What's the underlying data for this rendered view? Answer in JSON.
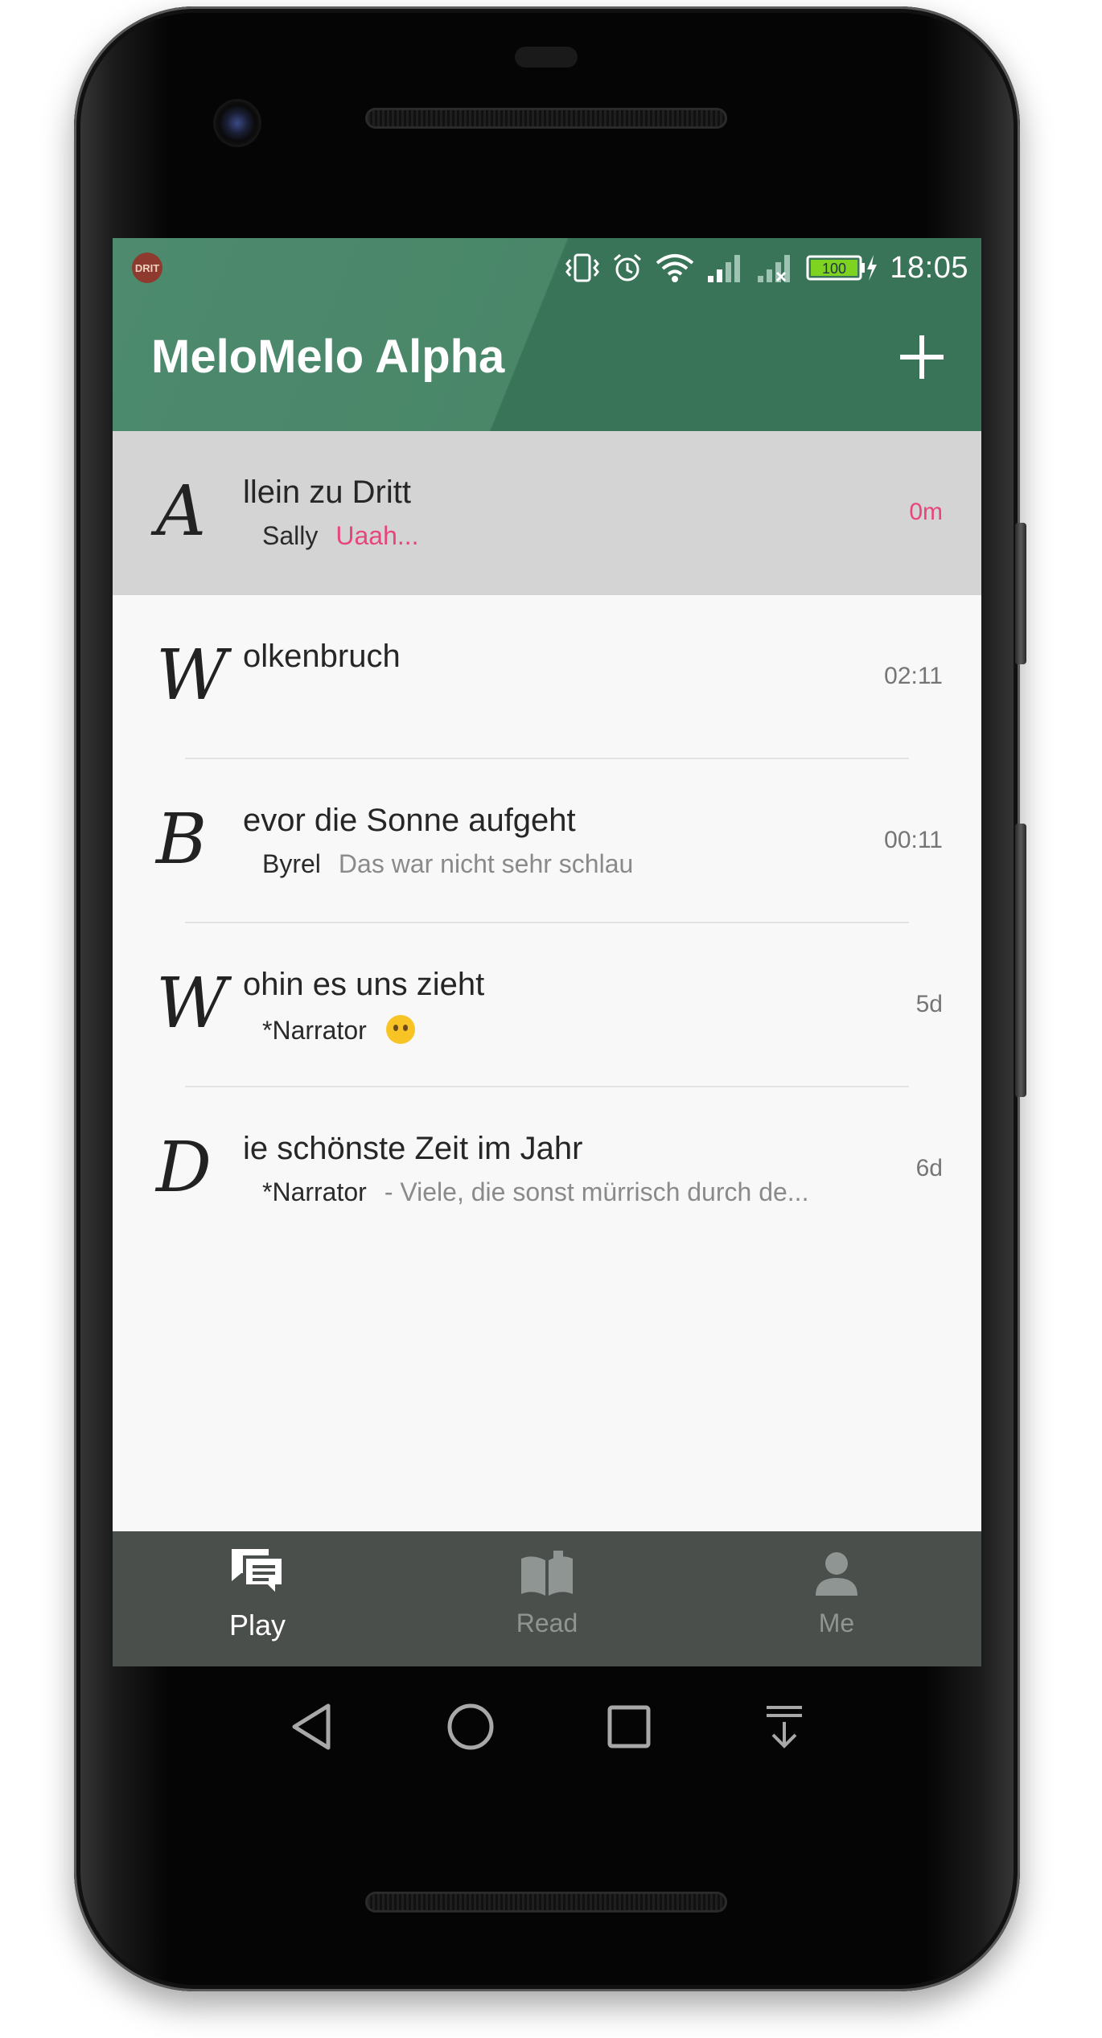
{
  "status_bar": {
    "time": "18:05",
    "battery": "100",
    "app_logo_text": "DRIT"
  },
  "app_bar": {
    "title": "MeloMelo Alpha",
    "add_icon": "plus-icon"
  },
  "conversations": [
    {
      "initial": "A",
      "title": "llein zu Dritt",
      "speaker": "Sally",
      "preview": "Uaah...",
      "time": "0m",
      "selected": true
    },
    {
      "initial": "W",
      "title": "olkenbruch",
      "speaker": "",
      "preview": "",
      "time": "02:11",
      "selected": false
    },
    {
      "initial": "B",
      "title": "evor die Sonne aufgeht",
      "speaker": "Byrel",
      "preview": "Das war nicht sehr schlau",
      "time": "00:11",
      "selected": false
    },
    {
      "initial": "W",
      "title": "ohin es uns zieht",
      "speaker": "*Narrator",
      "preview": "",
      "time": "5d",
      "selected": false,
      "emoji": "no-mouth-face-emoji"
    },
    {
      "initial": "D",
      "title": "ie schönste Zeit im Jahr",
      "speaker": "*Narrator",
      "preview": "- Viele, die sonst mürrisch durch de...",
      "time": "6d",
      "selected": false
    }
  ],
  "bottom_nav": {
    "items": [
      {
        "label": "Play",
        "icon": "chat-bubbles-icon",
        "active": true
      },
      {
        "label": "Read",
        "icon": "book-icon",
        "active": false
      },
      {
        "label": "Me",
        "icon": "person-icon",
        "active": false
      }
    ]
  },
  "colors": {
    "app_bar": "#4a8769",
    "accent_pink": "#e8457c",
    "bottom_nav": "#4a4f4c",
    "selected_row": "#d4d4d4"
  }
}
